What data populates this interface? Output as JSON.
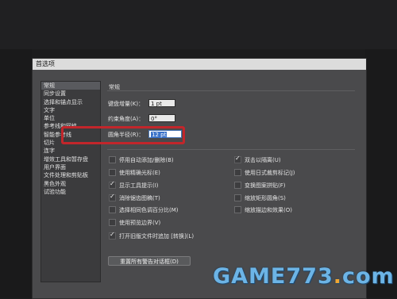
{
  "window": {
    "title": "首选项"
  },
  "sidebar": {
    "items": [
      {
        "label": "常规",
        "selected": true
      },
      {
        "label": "同步设置"
      },
      {
        "label": "选择和锚点显示"
      },
      {
        "label": "文字"
      },
      {
        "label": "单位"
      },
      {
        "label": "参考线和网格"
      },
      {
        "label": "智能参考线"
      },
      {
        "label": "切片"
      },
      {
        "label": "连字"
      },
      {
        "label": "增效工具和暂存盘"
      },
      {
        "label": "用户界面"
      },
      {
        "label": "文件处理和剪贴板"
      },
      {
        "label": "黑色外观"
      },
      {
        "label": "试验功能"
      }
    ]
  },
  "general": {
    "section_title": "常规",
    "keyboard_increment": {
      "label": "键盘增量(K)：",
      "value": "1 pt"
    },
    "constrain_angle": {
      "label": "约束角度(A)：",
      "value": "0°"
    },
    "corner_radius": {
      "label": "圆角半径(R)：",
      "value": "12 pt"
    },
    "checkboxes_left": [
      {
        "label": "停用自动添加/删除(B)",
        "checked": false
      },
      {
        "label": "使用精确光标(E)",
        "checked": false
      },
      {
        "label": "显示工具提示(I)",
        "checked": true
      },
      {
        "label": "消除锯齿图稿(T)",
        "checked": true
      },
      {
        "label": "选择相同色调百分比(M)",
        "checked": false
      },
      {
        "label": "使用预览边界(V)",
        "checked": false
      }
    ],
    "checkboxes_right": [
      {
        "label": "双击以隔离(U)",
        "checked": true
      },
      {
        "label": "使用日式裁剪标记(J)",
        "checked": false
      },
      {
        "label": "变换图案拼贴(F)",
        "checked": false
      },
      {
        "label": "缩放矩形圆角(S)",
        "checked": false
      },
      {
        "label": "缩放描边和效果(O)",
        "checked": false
      }
    ],
    "legacy_file": {
      "label": "打开旧版文件时追加 [转换](L)",
      "checked": true
    },
    "reset_button": "重置所有警告对话框(D)"
  },
  "watermark": {
    "text_main": "GAME773",
    "text_dot": ".",
    "text_tld": "com"
  },
  "colors": {
    "highlight": "#c2262b",
    "dialog_bg": "#4a4a4c",
    "selection": "#3a72c9"
  }
}
